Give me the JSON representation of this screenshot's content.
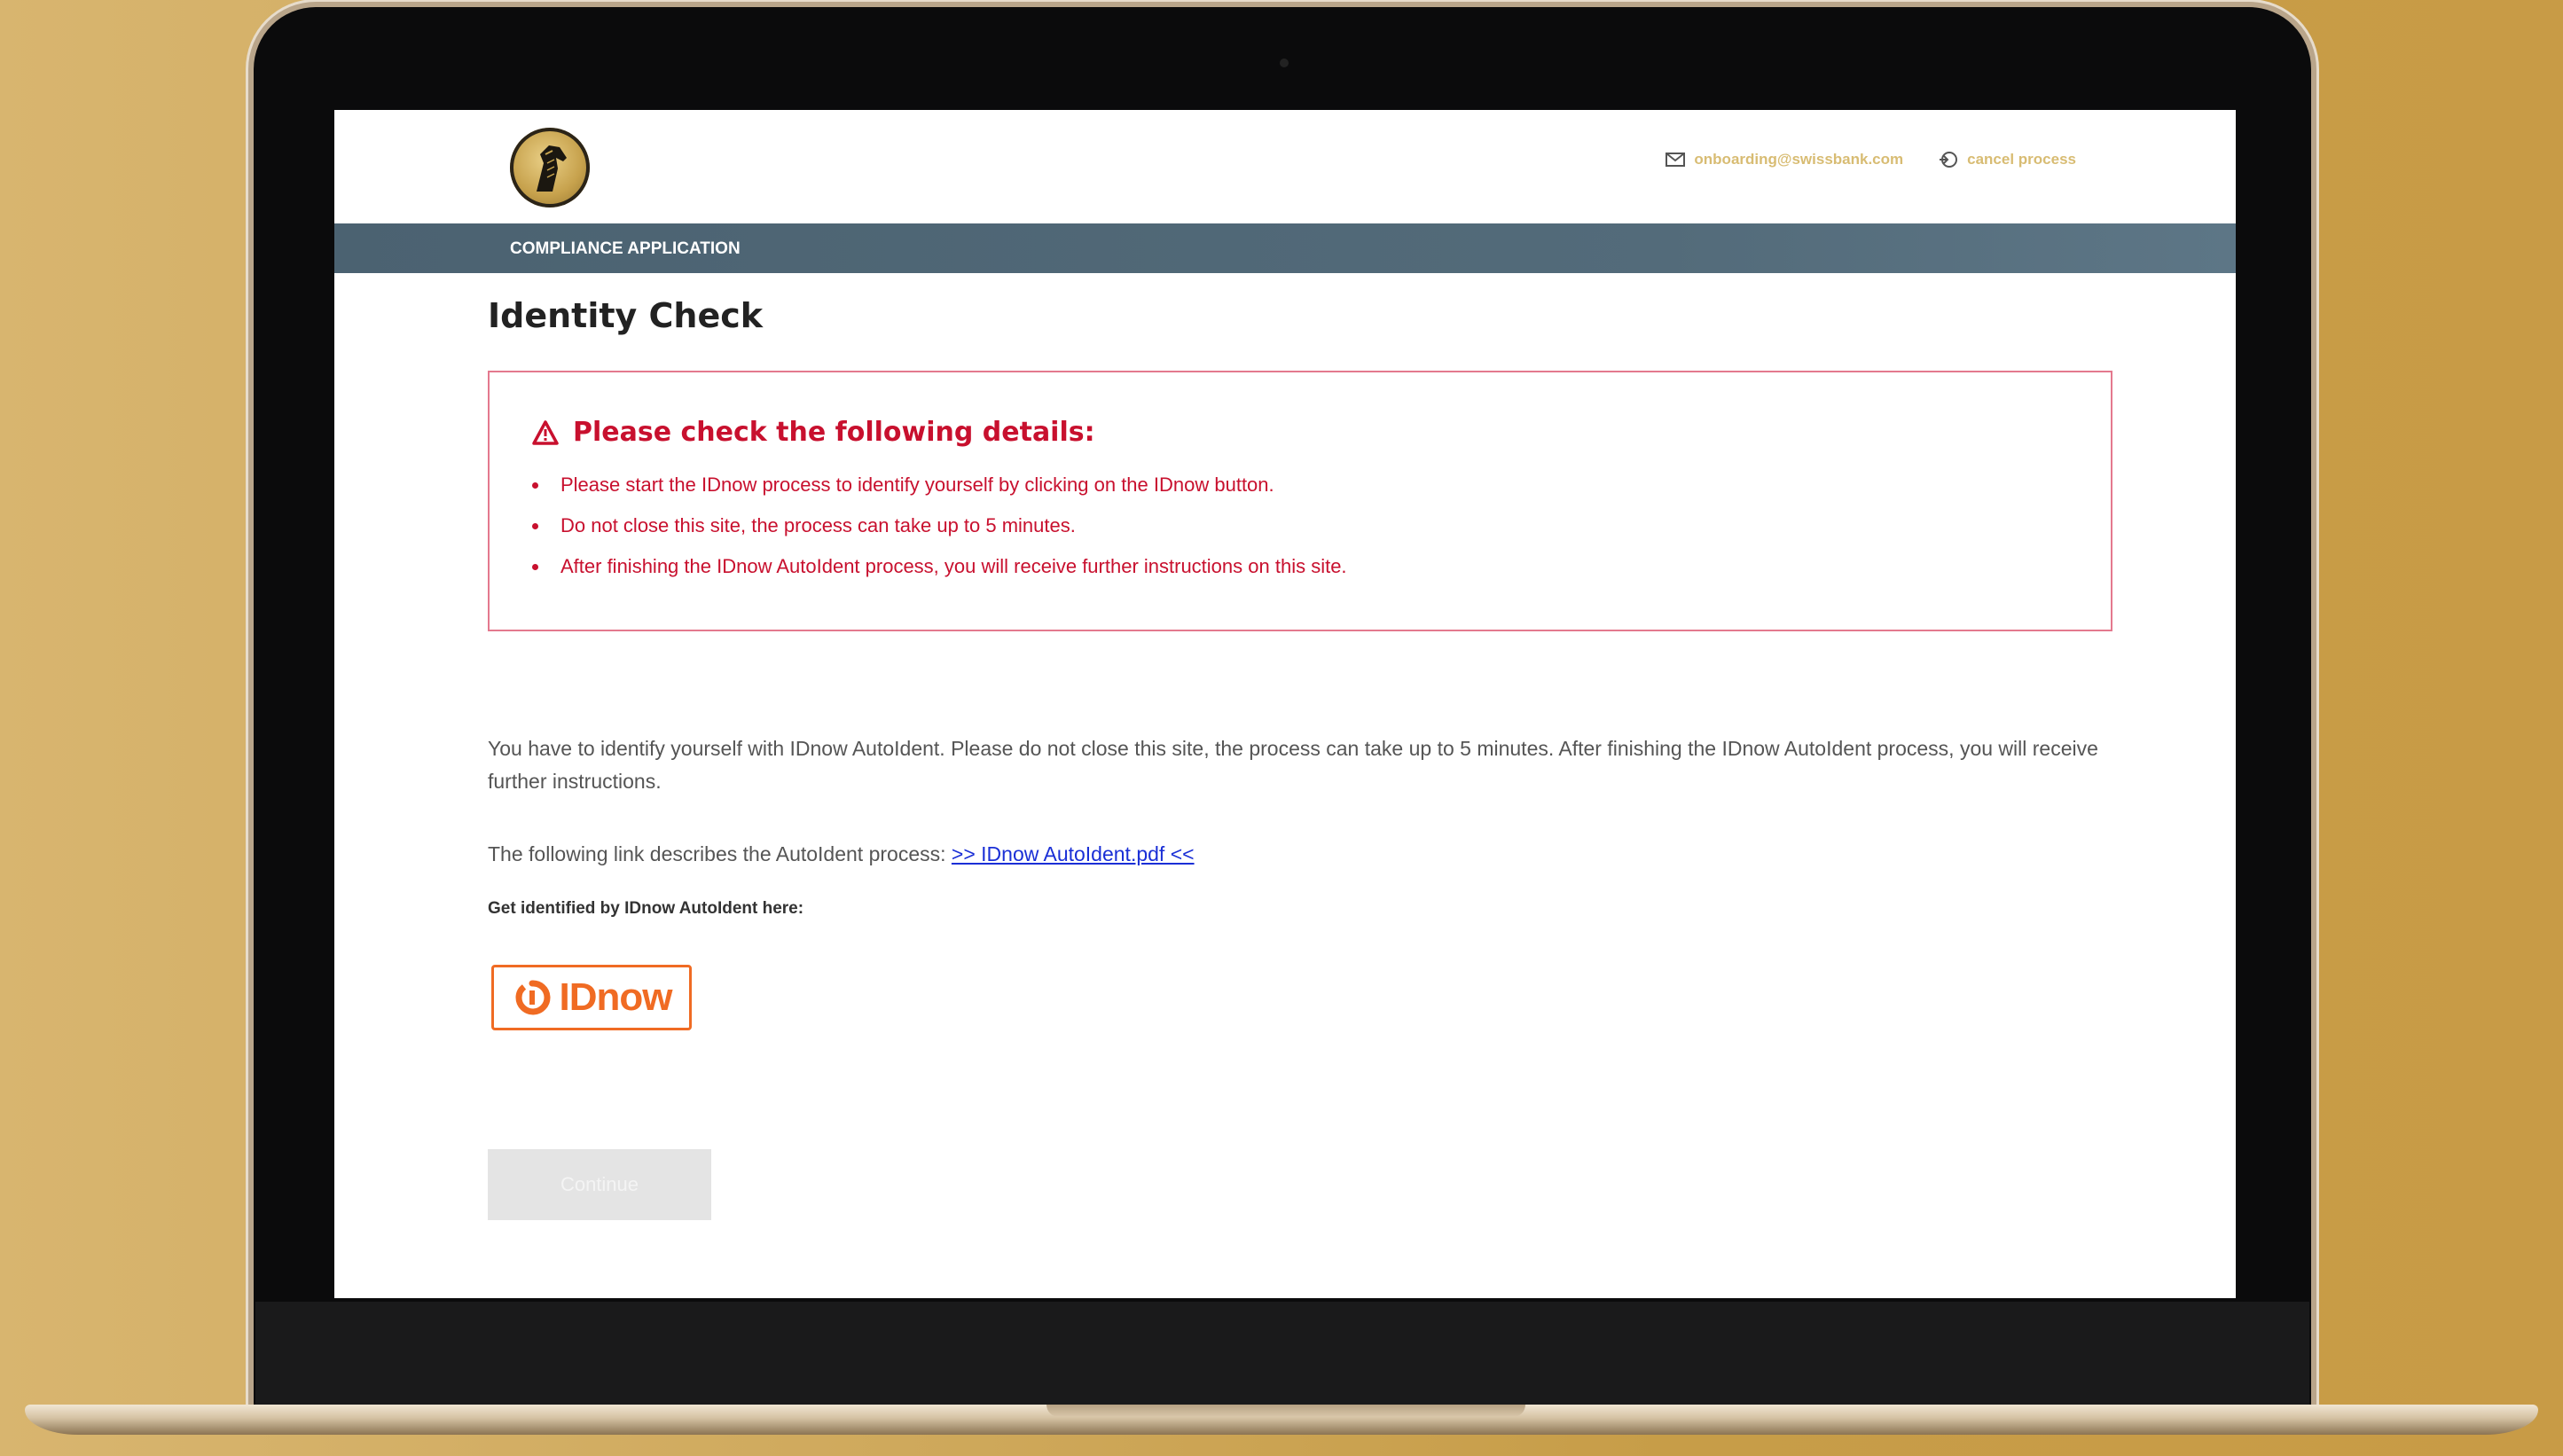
{
  "header": {
    "email": "onboarding@swissbank.com",
    "cancel_label": "cancel process"
  },
  "nav": {
    "title": "COMPLIANCE APPLICATION"
  },
  "page": {
    "title": "Identity Check"
  },
  "alert": {
    "heading": "Please check the following details:",
    "items": [
      "Please start the IDnow process to identify yourself by clicking on the IDnow button.",
      "Do not close this site, the process can take up to 5 minutes.",
      "After finishing the IDnow AutoIdent process, you will receive further instructions on this site."
    ],
    "color": "#c8102e"
  },
  "body": {
    "paragraph": "You have to identify yourself with IDnow AutoIdent. Please do not close this site, the process can take up to 5 minutes. After finishing the IDnow AutoIdent process, you will receive further instructions.",
    "link_prefix": "The following link describes the AutoIdent process:",
    "link_text": ">> IDnow AutoIdent.pdf <<",
    "get_identified": "Get identified by IDnow AutoIdent here:"
  },
  "idnow_button": {
    "label": "IDnow",
    "color": "#f06b23"
  },
  "continue_button": {
    "label": "Continue"
  },
  "icons": [
    "horse-logo-icon",
    "mail-icon",
    "logout-icon",
    "warning-icon",
    "idnow-logo-icon"
  ]
}
